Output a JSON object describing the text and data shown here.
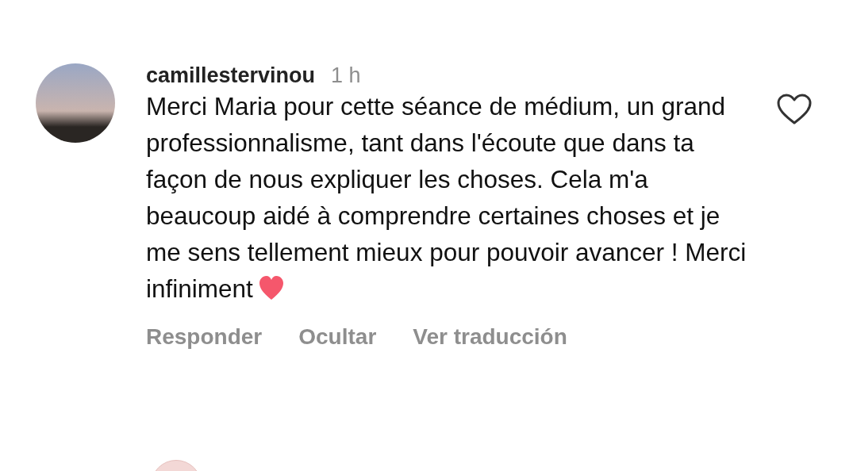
{
  "comment": {
    "username": "camillestervinou",
    "time": "1 h",
    "text": "Merci Maria pour cette séance de médium, un grand professionnalisme, tant dans l'écoute que dans ta façon de nous expliquer les choses. Cela m'a beaucoup aidé à comprendre certaines choses et je me sens tellement mieux pour pouvoir avancer ! Merci infiniment",
    "liked": false,
    "actions": [
      "Responder",
      "Ocultar",
      "Ver traducción"
    ]
  }
}
